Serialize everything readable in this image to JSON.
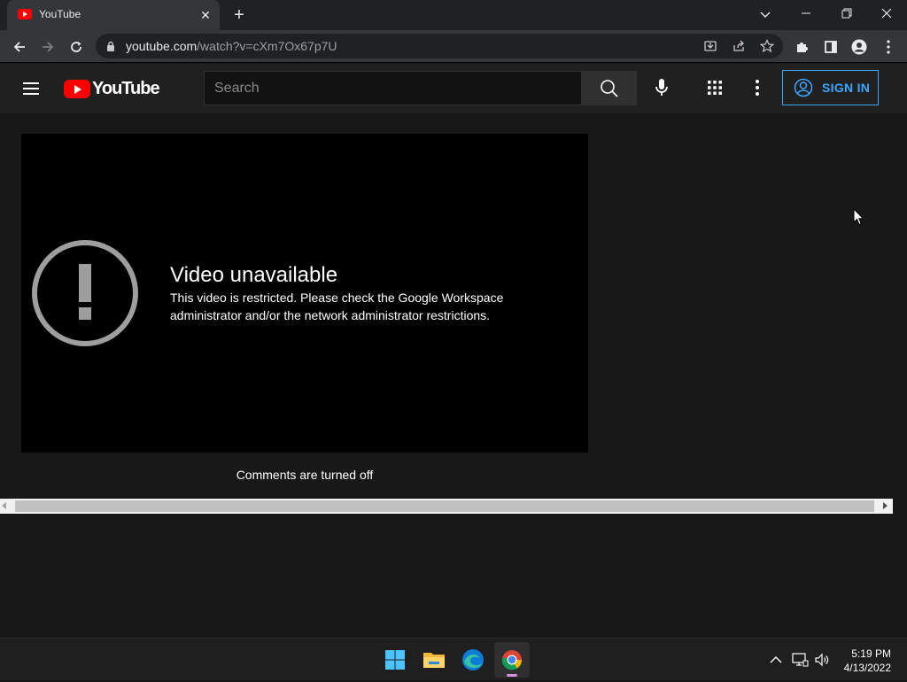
{
  "browser": {
    "tab_title": "YouTube",
    "url_host": "youtube.com",
    "url_path": "/watch?v=cXm7Ox67p7U"
  },
  "youtube": {
    "logo_text": "YouTube",
    "search_placeholder": "Search",
    "sign_in_label": "SIGN IN",
    "brand_color": "#ff0000",
    "accent_color": "#3ea6ff"
  },
  "player": {
    "error_title": "Video unavailable",
    "error_desc_line1": "This video is restricted. Please check the Google Workspace",
    "error_desc_line2": "administrator and/or the network administrator restrictions."
  },
  "comments_status": "Comments are turned off",
  "taskbar": {
    "time": "5:19 PM",
    "date": "4/13/2022"
  }
}
